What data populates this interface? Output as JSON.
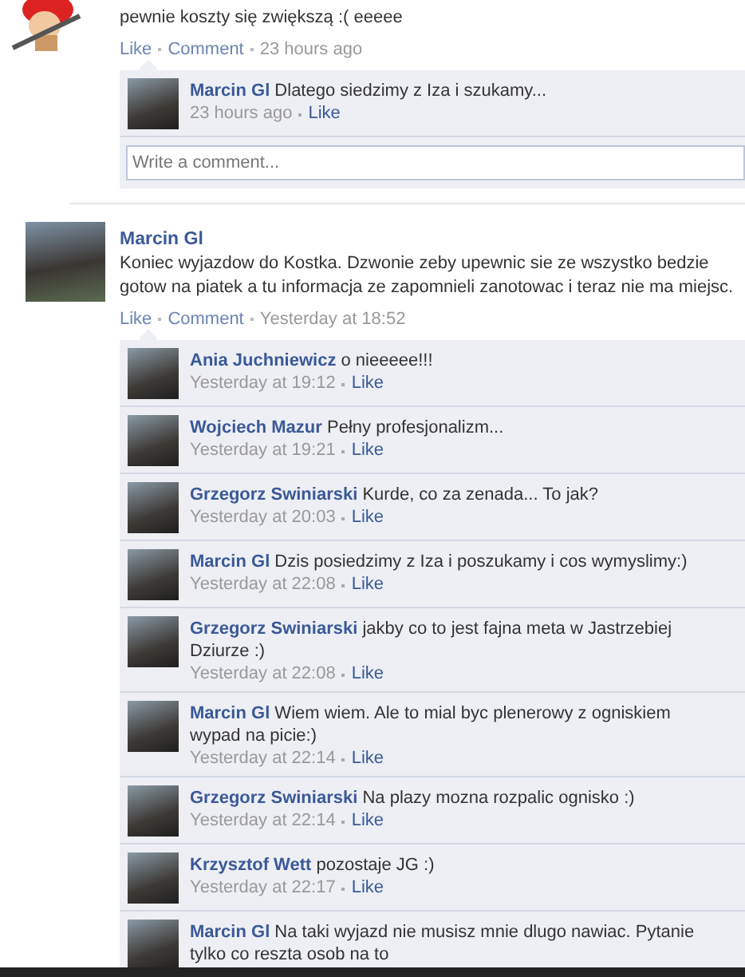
{
  "posts": [
    {
      "kind": "cartoon",
      "text": "pewnie koszty się zwiększą :( eeeee",
      "actions": [
        "Like",
        "Comment"
      ],
      "time": "23 hours ago",
      "comments": [
        {
          "name": "Marcin Gl",
          "text": "Dlatego siedzimy z Iza i szukamy...",
          "time": "23 hours ago",
          "like": "Like"
        }
      ],
      "comment_field": {
        "placeholder": "Write a comment..."
      }
    },
    {
      "kind": "photo",
      "name": "Marcin Gl",
      "text": "Koniec wyjazdow do Kostka. Dzwonie zeby upewnic sie ze wszystko bedzie gotow na piatek a tu informacja ze zapomnieli zanotowac i teraz nie ma miejsc.",
      "actions": [
        "Like",
        "Comment"
      ],
      "time": "Yesterday at 18:52",
      "comments": [
        {
          "name": "Ania Juchniewicz",
          "text": "o nieeeee!!!",
          "time": "Yesterday at 19:12",
          "like": "Like"
        },
        {
          "name": "Wojciech Mazur",
          "text": "Pełny profesjonalizm...",
          "time": "Yesterday at 19:21",
          "like": "Like"
        },
        {
          "name": "Grzegorz Swiniarski",
          "text": "Kurde, co za zenada... To jak?",
          "time": "Yesterday at 20:03",
          "like": "Like"
        },
        {
          "name": "Marcin Gl",
          "text": "Dzis posiedzimy z Iza i poszukamy i cos wymyslimy:)",
          "time": "Yesterday at 22:08",
          "like": "Like"
        },
        {
          "name": "Grzegorz Swiniarski",
          "text": "jakby co to jest fajna meta w Jastrzebiej Dziurze :)",
          "time": "Yesterday at 22:08",
          "like": "Like"
        },
        {
          "name": "Marcin Gl",
          "text": "Wiem wiem. Ale to mial byc plenerowy z ogniskiem wypad na picie:)",
          "time": "Yesterday at 22:14",
          "like": "Like"
        },
        {
          "name": "Grzegorz Swiniarski",
          "text": "Na plazy mozna rozpalic ognisko :)",
          "time": "Yesterday at 22:14",
          "like": "Like"
        },
        {
          "name": "Krzysztof Wett",
          "text": "pozostaje JG :)",
          "time": "Yesterday at 22:17",
          "like": "Like"
        },
        {
          "name": "Marcin Gl",
          "text": "Na taki wyjazd nie musisz mnie dlugo nawiac. Pytanie tylko co reszta osob na to"
        }
      ]
    }
  ]
}
